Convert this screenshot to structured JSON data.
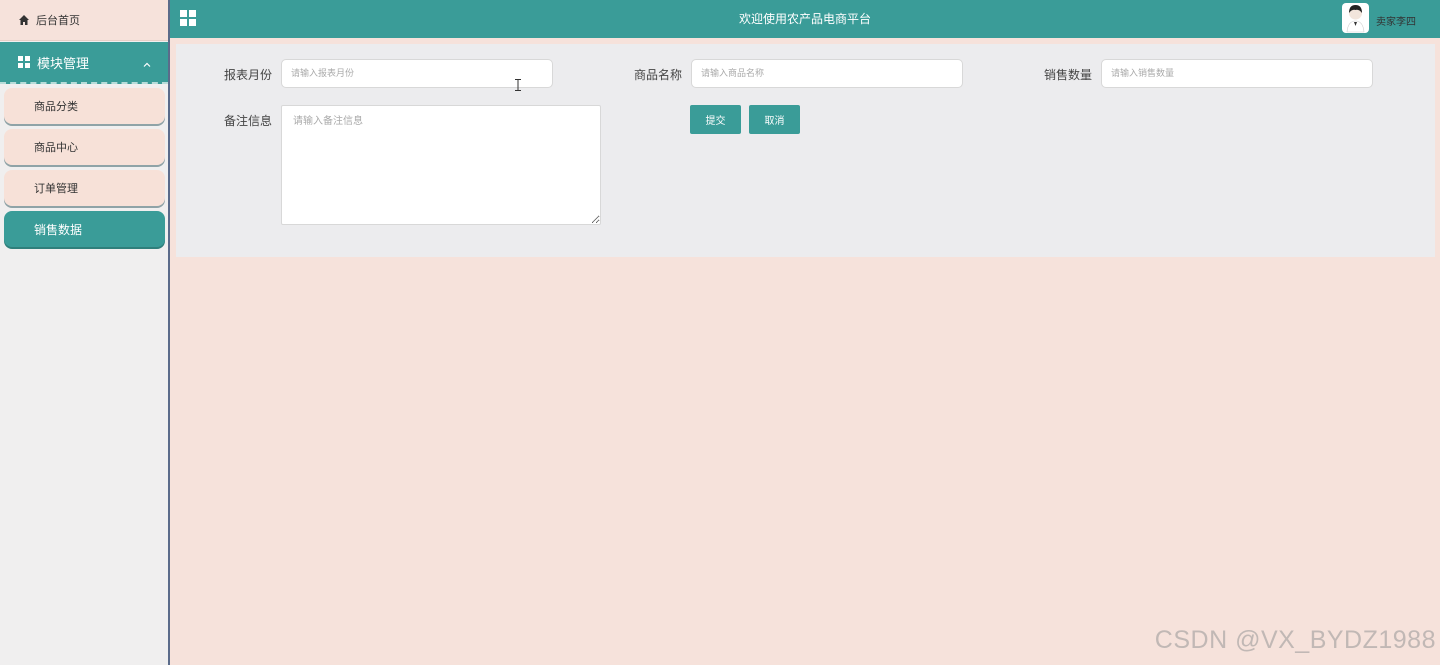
{
  "sidebar": {
    "home_label": "后台首页",
    "module_label": "模块管理",
    "items": [
      {
        "label": "商品分类",
        "active": false
      },
      {
        "label": "商品中心",
        "active": false
      },
      {
        "label": "订单管理",
        "active": false
      },
      {
        "label": "销售数据",
        "active": true
      }
    ]
  },
  "header": {
    "title": "欢迎使用农产品电商平台",
    "username": "卖家李四",
    "accent_color": "#3a9c98"
  },
  "form": {
    "report_month": {
      "label": "报表月份",
      "placeholder": "请输入报表月份",
      "value": ""
    },
    "product_name": {
      "label": "商品名称",
      "placeholder": "请输入商品名称",
      "value": ""
    },
    "sales_qty": {
      "label": "销售数量",
      "placeholder": "请输入销售数量",
      "value": ""
    },
    "remark": {
      "label": "备注信息",
      "placeholder": "请输入备注信息",
      "value": ""
    },
    "submit_label": "提交",
    "cancel_label": "取消"
  },
  "watermark": "CSDN @VX_BYDZ1988"
}
